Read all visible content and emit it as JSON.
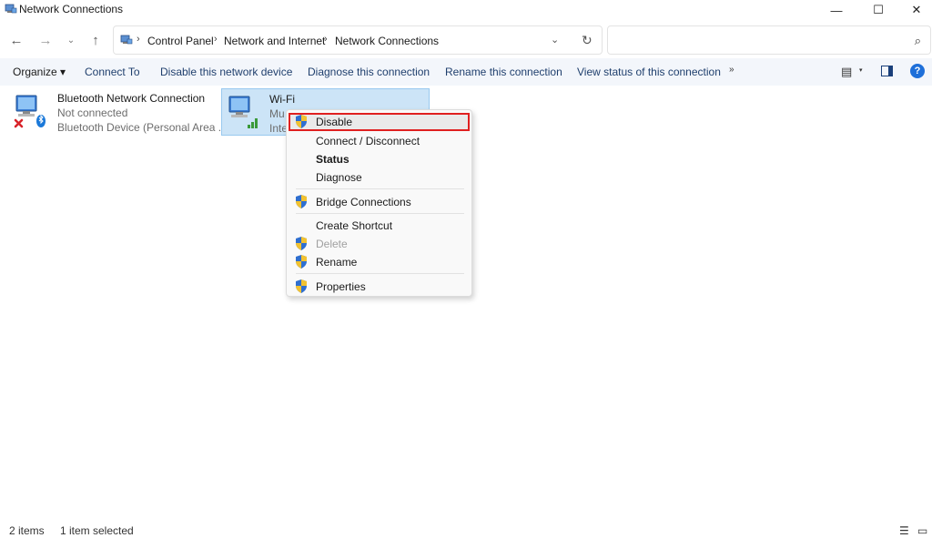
{
  "window": {
    "title": "Network Connections",
    "minimize_glyph": "—",
    "maximize_glyph": "☐",
    "close_glyph": "✕"
  },
  "nav": {
    "back_icon": "←",
    "forward_icon": "→",
    "recent_icon": "⌄",
    "up_icon": "↑"
  },
  "address": {
    "crumbs": [
      "Control Panel",
      "Network and Internet",
      "Network Connections"
    ],
    "separator": "›",
    "dropdown_icon": "⌄",
    "refresh_icon": "↻"
  },
  "search": {
    "value": "",
    "placeholder": "",
    "icon": "⌕"
  },
  "commands": {
    "organize": "Organize ▾",
    "connect_to": "Connect To",
    "disable_device": "Disable this network device",
    "diagnose": "Diagnose this connection",
    "rename": "Rename this connection",
    "view_status": "View status of this connection",
    "more": "»",
    "view_options_icon": "▤",
    "view_options_dd": "▾",
    "help": "?"
  },
  "items": [
    {
      "name": "Bluetooth Network Connection",
      "status": "Not connected",
      "device": "Bluetooth Device (Personal Area ...",
      "icon": "bluetooth-network-icon"
    },
    {
      "name": "Wi-Fi",
      "status": "Mu",
      "device": "Inte",
      "icon": "wifi-network-icon",
      "selected": true
    }
  ],
  "context_menu": {
    "disable": "Disable",
    "connect_disconnect": "Connect / Disconnect",
    "status": "Status",
    "diagnose": "Diagnose",
    "bridge": "Bridge Connections",
    "create_shortcut": "Create Shortcut",
    "delete": "Delete",
    "rename": "Rename",
    "properties": "Properties"
  },
  "statusbar": {
    "item_count": "2 items",
    "selected": "1 item selected",
    "details_icon": "☰",
    "tiles_icon": "▭"
  },
  "colors": {
    "selection_bg": "#cce4f7",
    "highlight_border": "#e02020",
    "command_text": "#1f3f6d",
    "help_blue": "#1e6fd9"
  }
}
